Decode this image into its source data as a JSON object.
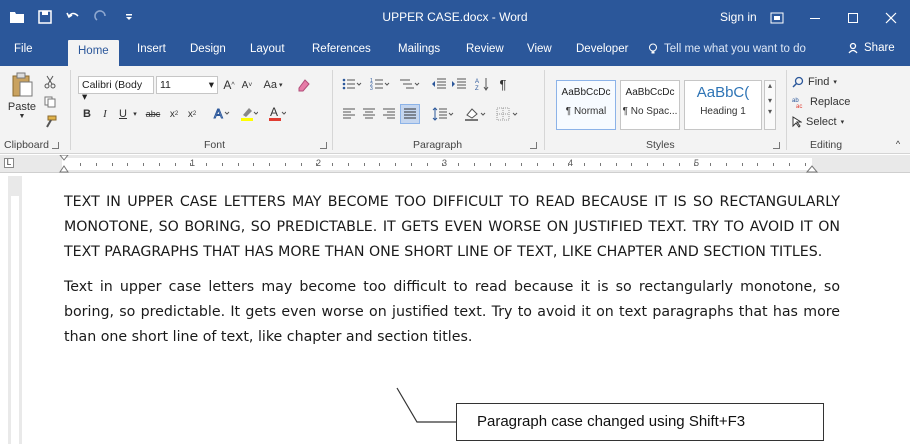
{
  "window": {
    "title": "UPPER CASE.docx - Word",
    "sign_in": "Sign in"
  },
  "tabs": [
    "File",
    "Home",
    "Insert",
    "Design",
    "Layout",
    "References",
    "Mailings",
    "Review",
    "View",
    "Developer"
  ],
  "active_tab": "Home",
  "tell_me": "Tell me what you want to do",
  "share": "Share",
  "ribbon": {
    "clipboard": {
      "label": "Clipboard",
      "paste": "Paste"
    },
    "font": {
      "label": "Font",
      "name": "Calibri (Body",
      "size": "11",
      "change_case": "Aa"
    },
    "paragraph": {
      "label": "Paragraph"
    },
    "styles": {
      "label": "Styles",
      "items": [
        {
          "sample": "AaBbCcDc",
          "name": "¶ Normal"
        },
        {
          "sample": "AaBbCcDc",
          "name": "¶ No Spac..."
        },
        {
          "sample": "AaBbC(",
          "name": "Heading 1"
        }
      ]
    },
    "editing": {
      "label": "Editing",
      "find": "Find",
      "replace": "Replace",
      "select": "Select"
    }
  },
  "ruler_numbers": [
    "1",
    "2",
    "3",
    "4",
    "5"
  ],
  "document": {
    "paragraph1": "TEXT IN UPPER CASE LETTERS MAY BECOME TOO DIFFICULT TO READ BECAUSE IT IS SO RECTANGULARLY MONOTONE, SO BORING, SO PREDICTABLE. IT GETS EVEN WORSE ON JUSTIFIED TEXT. TRY TO AVOID IT ON TEXT PARAGRAPHS THAT HAS MORE THAN ONE SHORT LINE OF TEXT, LIKE CHAPTER AND SECTION TITLES.",
    "paragraph2": "Text in upper case letters may become too difficult to read because it is so rectangularly monotone, so boring, so predictable. It gets even worse on justified text. Try to avoid it on text paragraphs that has more than one short line of text, like chapter and section titles."
  },
  "callout": "Paragraph case changed using Shift+F3",
  "colors": {
    "accent": "#2b579a",
    "ribbon": "#f3f3f3"
  }
}
